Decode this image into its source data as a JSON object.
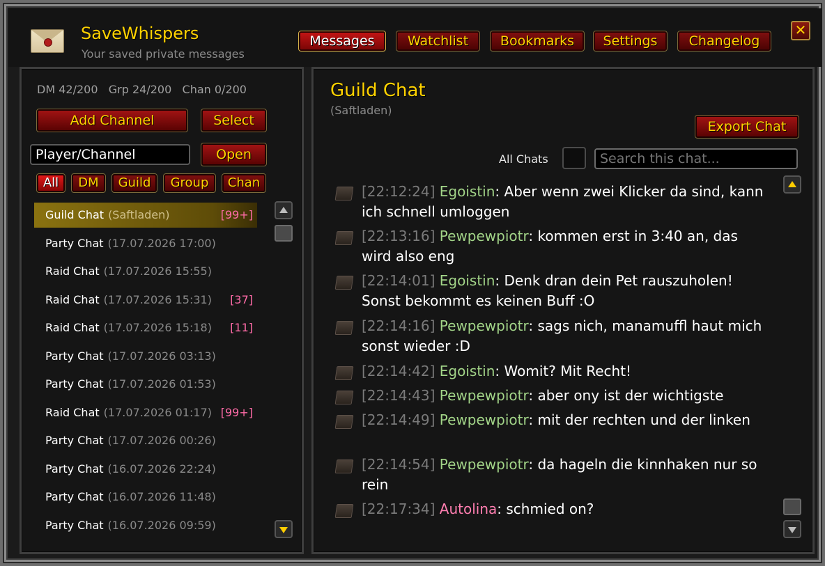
{
  "app": {
    "title": "SaveWhispers",
    "subtitle": "Your saved private messages",
    "close_label": "✕"
  },
  "tabs": [
    {
      "label": "Messages",
      "active": true
    },
    {
      "label": "Watchlist",
      "active": false
    },
    {
      "label": "Bookmarks",
      "active": false
    },
    {
      "label": "Settings",
      "active": false
    },
    {
      "label": "Changelog",
      "active": false
    }
  ],
  "sidebar": {
    "counts": "DM 42/200   Grp 24/200   Chan 0/200",
    "add_channel_label": "Add Channel",
    "select_label": "Select",
    "channel_input": {
      "value": "Player/Channel"
    },
    "open_label": "Open",
    "filters": [
      {
        "label": "All",
        "active": true
      },
      {
        "label": "DM",
        "active": false
      },
      {
        "label": "Guild",
        "active": false
      },
      {
        "label": "Group",
        "active": false
      },
      {
        "label": "Chan",
        "active": false
      }
    ],
    "channels": [
      {
        "name": "Guild Chat",
        "date": "(Saftladen)",
        "badge": "[99+]",
        "selected": true
      },
      {
        "name": "Party Chat",
        "date": "(17.07.2026 17:00)",
        "badge": ""
      },
      {
        "name": "Raid Chat",
        "date": "(17.07.2026 15:55)",
        "badge": ""
      },
      {
        "name": "Raid Chat",
        "date": "(17.07.2026 15:31)",
        "badge": "[37]"
      },
      {
        "name": "Raid Chat",
        "date": "(17.07.2026 15:18)",
        "badge": "[11]"
      },
      {
        "name": "Party Chat",
        "date": "(17.07.2026 03:13)",
        "badge": ""
      },
      {
        "name": "Party Chat",
        "date": "(17.07.2026 01:53)",
        "badge": ""
      },
      {
        "name": "Raid Chat",
        "date": "(17.07.2026 01:17)",
        "badge": "[99+]"
      },
      {
        "name": "Party Chat",
        "date": "(17.07.2026 00:26)",
        "badge": ""
      },
      {
        "name": "Party Chat",
        "date": "(16.07.2026 22:24)",
        "badge": ""
      },
      {
        "name": "Party Chat",
        "date": "(16.07.2026 11:48)",
        "badge": ""
      },
      {
        "name": "Party Chat",
        "date": "(16.07.2026 09:59)",
        "badge": ""
      }
    ]
  },
  "chat": {
    "title": "Guild Chat",
    "subtitle": "(Saftladen)",
    "export_label": "Export Chat",
    "all_chats_label": "All Chats",
    "search": {
      "placeholder": "Search this chat..."
    },
    "messages": [
      {
        "time": "[22:12:24]",
        "sender": "Egoistin",
        "sender_color": "#a2d488",
        "text": "Aber wenn zwei Klicker da sind, kann ich schnell umloggen"
      },
      {
        "time": "[22:13:16]",
        "sender": "Pewpewpiotr",
        "sender_color": "#a2d488",
        "text": "kommen erst in 3:40 an, das wird also eng"
      },
      {
        "time": "[22:14:01]",
        "sender": "Egoistin",
        "sender_color": "#a2d488",
        "text": "Denk dran dein Pet rauszuholen! Sonst bekommt es keinen Buff :O"
      },
      {
        "time": "[22:14:16]",
        "sender": "Pewpewpiotr",
        "sender_color": "#a2d488",
        "text": "sags nich, manamuffl haut mich sonst wieder :D"
      },
      {
        "time": "[22:14:42]",
        "sender": "Egoistin",
        "sender_color": "#a2d488",
        "text": "Womit? Mit Recht!"
      },
      {
        "time": "[22:14:43]",
        "sender": "Pewpewpiotr",
        "sender_color": "#a2d488",
        "text": "aber ony ist der wichtigste"
      },
      {
        "time": "[22:14:49]",
        "sender": "Pewpewpiotr",
        "sender_color": "#a2d488",
        "text": "mit der rechten und der linken"
      },
      {
        "time": "[22:14:54]",
        "sender": "Pewpewpiotr",
        "sender_color": "#a2d488",
        "text": "da hageln die kinnhaken nur so rein"
      },
      {
        "time": "[22:17:34]",
        "sender": "Autolina",
        "sender_color": "#ff7eb0",
        "text": "schmied on?"
      }
    ]
  }
}
